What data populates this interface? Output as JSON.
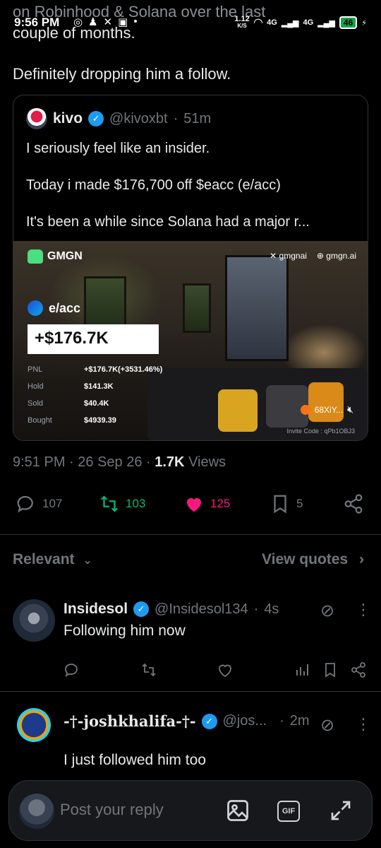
{
  "status_bar": {
    "time": "9:56 PM",
    "net_speed": "1.12",
    "net_unit": "K/S",
    "signal1": "4G",
    "signal2": "4G",
    "battery": "46"
  },
  "scrolled_text": {
    "line1": "on Robinhood & Solana over the last",
    "line2": "couple of months.",
    "line3": "Definitely dropping him a follow."
  },
  "quoted_post": {
    "name": "kivo",
    "handle": "@kivoxbt",
    "time": "51m",
    "line1": "I seriously feel like an insider.",
    "line2": "Today i made $176,700 off $eacc (e/acc)",
    "line3": "It's been a while since Solana had a major r..."
  },
  "media": {
    "brand": "GMGN",
    "x_handle": "gmgnai",
    "site": "gmgn.ai",
    "token": "e/acc",
    "pnl_big": "+$176.7K",
    "stats": [
      {
        "label": "PNL",
        "value": "+$176.7K(+3531.46%)"
      },
      {
        "label": "Hold",
        "value": "$141.3K"
      },
      {
        "label": "Sold",
        "value": "$40.4K"
      },
      {
        "label": "Bought",
        "value": "$4939.39"
      }
    ],
    "user_chip": "68XiY...",
    "invite": "Invite Code : qPb1OBJ3"
  },
  "meta": {
    "time": "9:51 PM",
    "date": "26 Sep 26",
    "views_count": "1.7K",
    "views_label": "Views"
  },
  "actions": {
    "replies": "107",
    "reposts": "103",
    "likes": "125",
    "bookmarks": "5"
  },
  "sort": {
    "relevant": "Relevant",
    "view_quotes": "View quotes"
  },
  "replies": [
    {
      "name": "Insidesol",
      "handle": "@Insidesol134",
      "time": "4s",
      "text": "Following him now"
    },
    {
      "name": "-†-joshkhalifa-†-",
      "handle": "@jos...",
      "time": "2m",
      "text": "I just followed him too"
    }
  ],
  "reply_bar": {
    "placeholder": "Post your reply",
    "gif": "GIF"
  },
  "colors": {
    "background": "#000000",
    "accent_blue": "#1d9bf0",
    "repost_green": "#00ba7c",
    "like_pink": "#f91880",
    "muted": "#71767b"
  }
}
